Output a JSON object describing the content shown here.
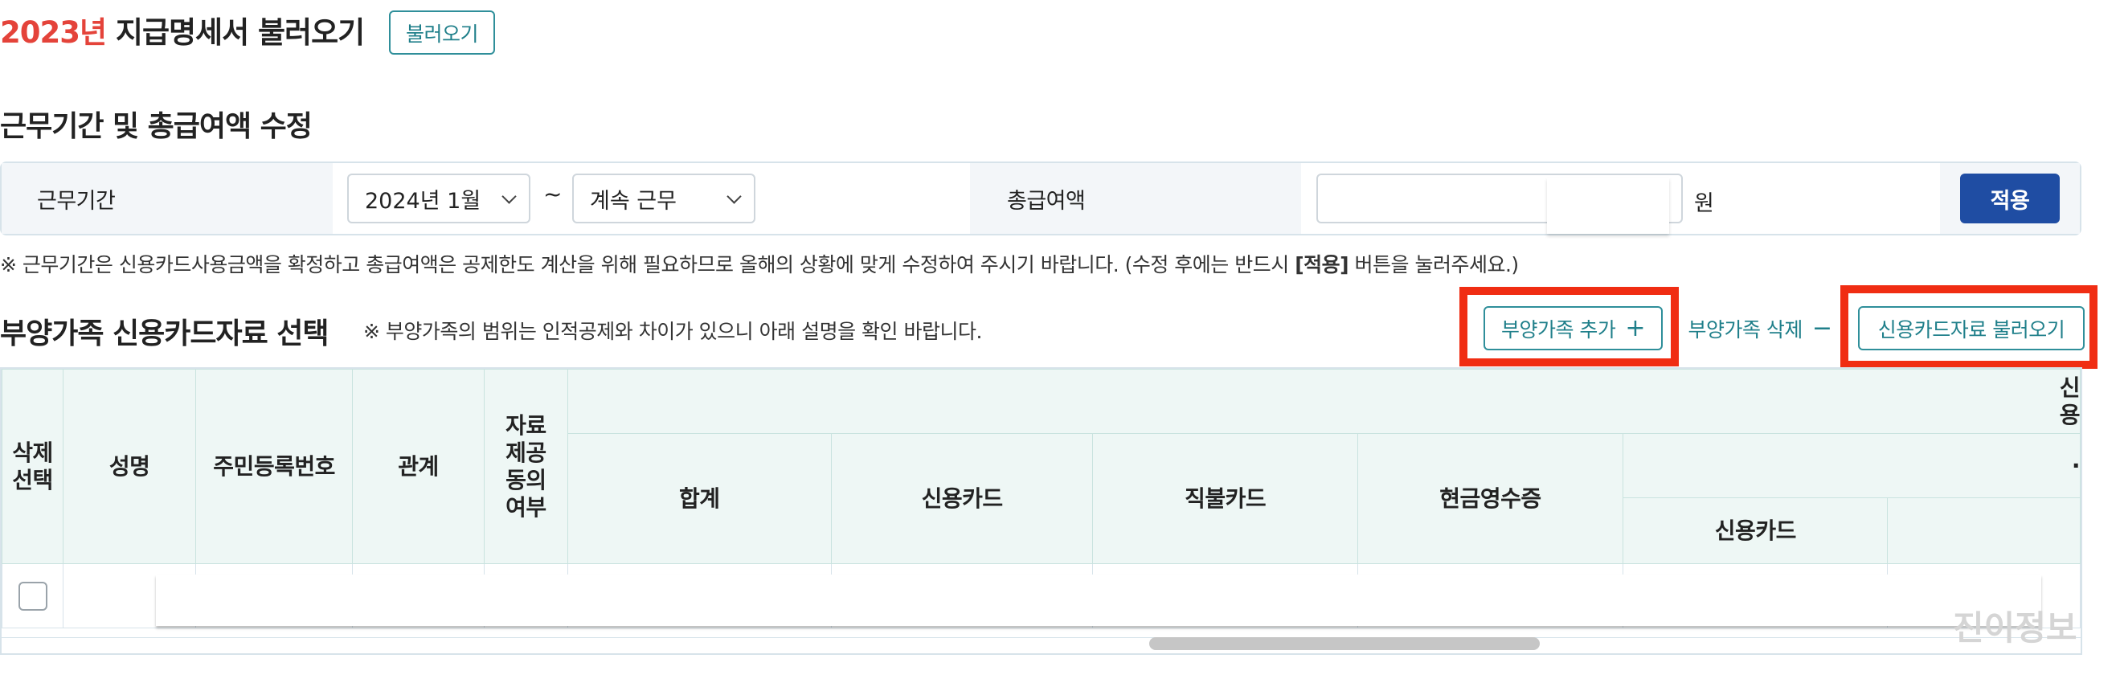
{
  "header": {
    "year": "2023년",
    "title": "지급명세서 불러오기",
    "load_button": "불러오기"
  },
  "period_section": {
    "title": "근무기간 및 총급여액 수정",
    "period_label": "근무기간",
    "start_value": "2024년 1월",
    "tilde": "~",
    "end_value": "계속 근무",
    "salary_label": "총급여액",
    "salary_value": "",
    "unit": "원",
    "apply_button": "적용",
    "note_prefix": "※ 근무기간은 신용카드사용금액을 확정하고 총급여액은 공제한도 계산을 위해 필요하므로 올해의 상황에 맞게 수정하여 주시기 바랍니다. (수정 후에는 반드시 ",
    "note_bold": "[적용]",
    "note_suffix": " 버튼을 눌러주세요.)"
  },
  "dependent_section": {
    "title": "부양가족 신용카드자료 선택",
    "note": "※ 부양가족의 범위는 인적공제와 차이가 있으니 아래 설명을 확인 바랍니다.",
    "add_button": "부양가족 추가",
    "delete_button": "부양가족 삭제",
    "load_card_button": "신용카드자료 불러오기"
  },
  "table": {
    "headers": {
      "delete_select": "삭제\n선택",
      "name": "성명",
      "rrn": "주민등록번호",
      "relation": "관계",
      "consent": "자료\n제공\n동의\n여부",
      "group_partial": "신용",
      "total": "합계",
      "credit_card": "신용카드",
      "debit_card": "직불카드",
      "cash_receipt": "현금영수증",
      "sub_credit_card": "신용카드",
      "sub_group_partial": "·"
    }
  },
  "watermark": "진이정보"
}
